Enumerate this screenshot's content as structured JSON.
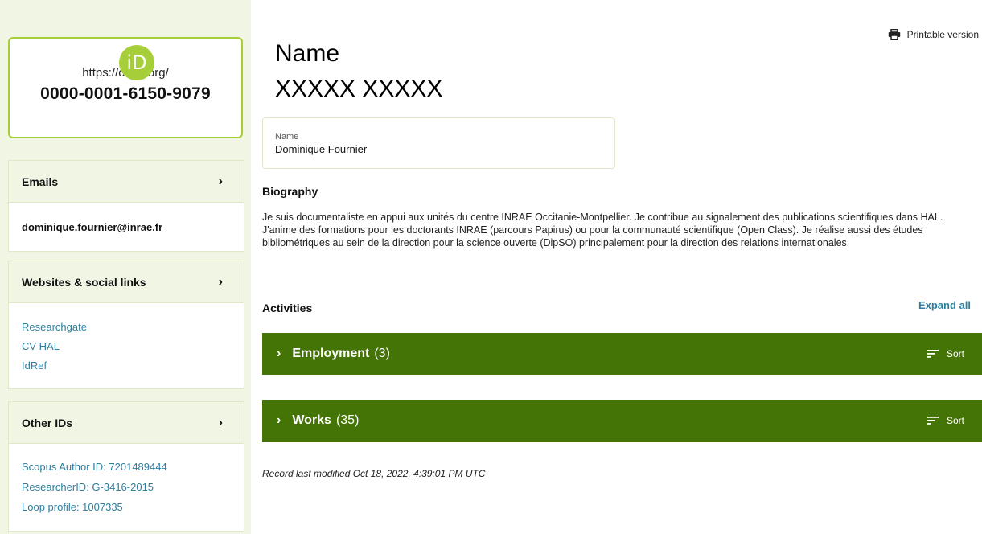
{
  "sidebar": {
    "orcid": {
      "logo_text": "iD",
      "url": "https://orcid.org/",
      "id": "0000-0001-6150-9079"
    },
    "emails": {
      "title": "Emails",
      "chevron": "›",
      "items": [
        "dominique.fournier@inrae.fr"
      ]
    },
    "websites": {
      "title": "Websites & social links",
      "chevron": "›",
      "items": [
        "Researchgate",
        "CV HAL",
        "IdRef"
      ]
    },
    "other_ids": {
      "title": "Other IDs",
      "chevron": "›",
      "items": [
        "Scopus Author ID: 7201489444",
        "ResearcherID: G-3416-2015",
        "Loop profile: 1007335"
      ]
    }
  },
  "header": {
    "title_line1": "Name",
    "title_line2": "XXXXX XXXXX",
    "printable_label": "Printable version",
    "printable_icon": "printer-icon"
  },
  "name_box": {
    "label": "Name",
    "value": "Dominique Fournier"
  },
  "biography": {
    "title": "Biography",
    "text": "Je suis documentaliste en appui aux unités du centre INRAE Occitanie-Montpellier. Je contribue au signalement des publications scientifiques dans HAL. J'anime des formations pour les doctorants INRAE (parcours Papirus) ou pour la communauté scientifique (Open Class). Je réalise aussi des études bibliométriques au sein de la direction pour la science ouverte (DipSO) principalement pour la direction des relations internationales."
  },
  "activities": {
    "title": "Activities",
    "expand_all": "Expand all",
    "sections": [
      {
        "name": "Employment",
        "count": "(3)",
        "sort_label": "Sort"
      },
      {
        "name": "Works",
        "count": "(35)",
        "sort_label": "Sort"
      }
    ]
  },
  "footer": {
    "modified": "Record last modified Oct 18, 2022, 4:39:01 PM UTC"
  },
  "colors": {
    "orcid_green": "#a6ce39",
    "section_green": "#447405",
    "sidebar_bg": "#f1f6e4",
    "link_blue": "#2e7f9f"
  }
}
